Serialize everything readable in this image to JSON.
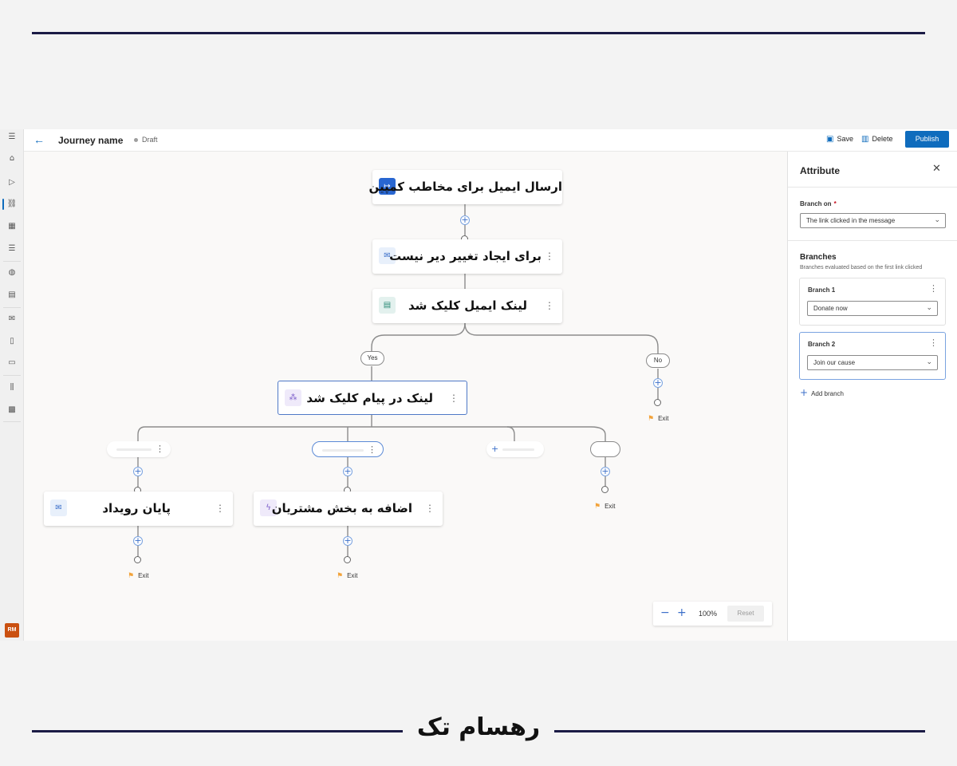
{
  "header": {
    "journey_name": "Journey name",
    "status": "Draft",
    "save_label": "Save",
    "delete_label": "Delete",
    "publish_label": "Publish"
  },
  "nav": {
    "avatar_initials": "RM",
    "icons": [
      "menu-icon",
      "home-icon",
      "play-icon",
      "journeys-icon",
      "segments-icon",
      "forms-icon",
      "events-icon",
      "content-icon",
      "email-icon",
      "push-icon",
      "sms-icon",
      "library-icon",
      "assets-icon"
    ]
  },
  "canvas": {
    "nodes": {
      "send_email": "ارسال ایمیل برای مخاطب کمپین",
      "wait": "برای ایجاد تغییر دیر نیست",
      "email_clicked": "لینک ایمیل کلیک شد",
      "link_clicked": "لینک در پیام کلیک شد",
      "end_event": "پایان رویداد",
      "add_segment": "اضافه به بخش مشتریان"
    },
    "labels": {
      "yes": "Yes",
      "no": "No",
      "exit": "Exit"
    },
    "zoom": {
      "value": "100%",
      "reset_label": "Reset"
    }
  },
  "panel": {
    "title": "Attribute",
    "branch_on_label": "Branch on",
    "branch_on_value": "The link clicked in the message",
    "branches_title": "Branches",
    "branches_subtitle": "Branches evaluated based on the first link clicked",
    "branches": [
      {
        "name": "Branch 1",
        "value": "Donate now"
      },
      {
        "name": "Branch 2",
        "value": "Join our cause"
      }
    ],
    "add_branch_label": "Add branch"
  },
  "brand": {
    "logo_text": "رهسام تک"
  },
  "colors": {
    "accent": "#0f6cbd",
    "frame_line": "#1b1b45",
    "avatar_bg": "#ca5010",
    "exit_flag": "#f2a33a"
  }
}
